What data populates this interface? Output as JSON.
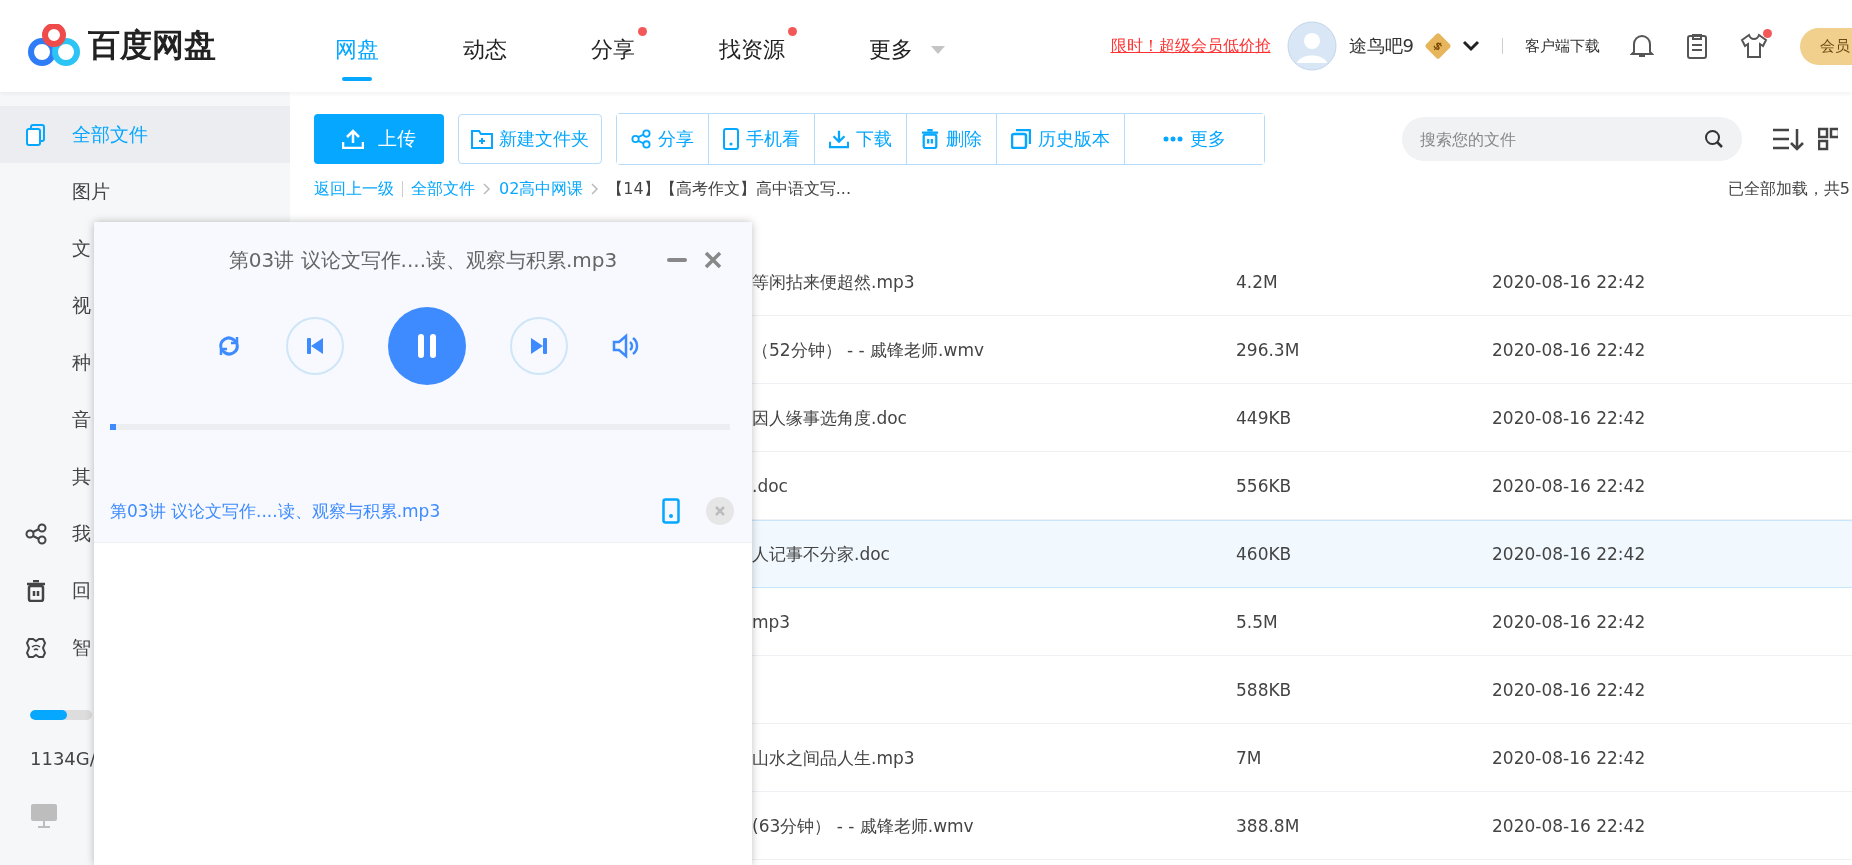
{
  "logo": {
    "text": "百度网盘"
  },
  "nav": [
    {
      "label": "网盘",
      "selected": true,
      "dot": false,
      "caret": false
    },
    {
      "label": "动态",
      "selected": false,
      "dot": false,
      "caret": false
    },
    {
      "label": "分享",
      "selected": false,
      "dot": true,
      "caret": false
    },
    {
      "label": "找资源",
      "selected": false,
      "dot": true,
      "caret": false
    },
    {
      "label": "更多",
      "selected": false,
      "dot": false,
      "caret": true
    }
  ],
  "promo": "限时！超级会员低价抢",
  "user": {
    "name": "途鸟吧9",
    "badge": "$"
  },
  "client_download": "客户端下载",
  "header_icons": [
    {
      "kind": "bell",
      "dot": false
    },
    {
      "kind": "clipboard",
      "dot": false
    },
    {
      "kind": "shirt",
      "dot": true
    }
  ],
  "member_button": "会员",
  "sidebar": {
    "items": [
      {
        "label": "全部文件",
        "kind": "files",
        "selected": true
      },
      {
        "label": "图片",
        "kind": "sub",
        "selected": false
      },
      {
        "label": "文",
        "kind": "sub",
        "selected": false
      },
      {
        "label": "视",
        "kind": "sub",
        "selected": false
      },
      {
        "label": "种",
        "kind": "sub",
        "selected": false
      },
      {
        "label": "音",
        "kind": "sub",
        "selected": false
      },
      {
        "label": "其",
        "kind": "sub",
        "selected": false
      },
      {
        "label": "我",
        "kind": "share",
        "selected": false
      },
      {
        "label": "回",
        "kind": "trash",
        "selected": false
      },
      {
        "label": "智",
        "kind": "smart",
        "selected": false
      }
    ],
    "storage": {
      "level": 0.6,
      "text": "1134G/"
    }
  },
  "toolbar": {
    "upload": "上传",
    "new_folder": "新建文件夹",
    "actions": [
      {
        "kind": "share",
        "label": "分享"
      },
      {
        "kind": "phone",
        "label": "手机看"
      },
      {
        "kind": "download",
        "label": "下载"
      },
      {
        "kind": "delete",
        "label": "删除"
      },
      {
        "kind": "history",
        "label": "历史版本"
      },
      {
        "kind": "more",
        "label": "更多"
      }
    ],
    "search": {
      "placeholder": "搜索您的文件"
    }
  },
  "breadcrumb": {
    "back": "返回上一级",
    "items": [
      "全部文件",
      "02高中网课",
      "【14】【高考作文】高中语文写..."
    ],
    "status": "已全部加载，共5"
  },
  "files": [
    {
      "name": "等闲拈来便超然.mp3",
      "size": "4.2M",
      "date": "2020-08-16 22:42",
      "selected": false
    },
    {
      "name": "（52分钟） - - 戚锋老师.wmv",
      "size": "296.3M",
      "date": "2020-08-16 22:42",
      "selected": false
    },
    {
      "name": "因人缘事选角度.doc",
      "size": "449KB",
      "date": "2020-08-16 22:42",
      "selected": false
    },
    {
      "name": ".doc",
      "size": "556KB",
      "date": "2020-08-16 22:42",
      "selected": false
    },
    {
      "name": "人记事不分家.doc",
      "size": "460KB",
      "date": "2020-08-16 22:42",
      "selected": true
    },
    {
      "name": "mp3",
      "size": "5.5M",
      "date": "2020-08-16 22:42",
      "selected": false
    },
    {
      "size": "588KB",
      "date": "2020-08-16 22:42",
      "selected": false
    },
    {
      "name": "山水之间品人生.mp3",
      "size": "7M",
      "date": "2020-08-16 22:42",
      "selected": false
    },
    {
      "name": "(63分钟） - - 戚锋老师.wmv",
      "size": "388.8M",
      "date": "2020-08-16 22:42",
      "selected": false
    }
  ],
  "player": {
    "title": "第03讲 议论文写作....读、观察与积累.mp3",
    "playing": true,
    "progress": {
      "level": 0.01
    },
    "playlist": [
      {
        "name": "第03讲 议论文写作....读、观察与积累.mp3",
        "selected": true
      }
    ]
  }
}
